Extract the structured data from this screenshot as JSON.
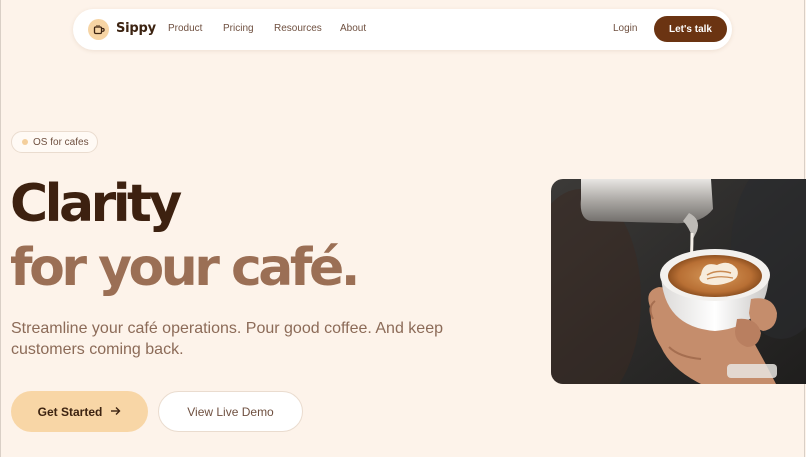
{
  "nav": {
    "brand": "Sippy",
    "links": [
      "Product",
      "Pricing",
      "Resources",
      "About"
    ],
    "login": "Login",
    "cta": "Let's talk"
  },
  "hero": {
    "badge": "OS for cafes",
    "headline_line1": "Clarity",
    "headline_line2": "for your café.",
    "subhead": "Streamline your café operations. Pour good coffee. And keep customers coming back.",
    "primary_cta": "Get Started",
    "secondary_cta": "View Live Demo",
    "image": "latte-art-pour-photo"
  },
  "colors": {
    "background": "#fdf3ea",
    "brand_dark": "#6b3412",
    "headline_dark": "#3d2110",
    "headline_accent": "#9b6f55",
    "primary_button": "#f8d6a6"
  },
  "icons": {
    "logo": "coffee-cup-icon",
    "cta_arrow": "arrow-right-icon",
    "badge_dot": "dot-icon"
  }
}
